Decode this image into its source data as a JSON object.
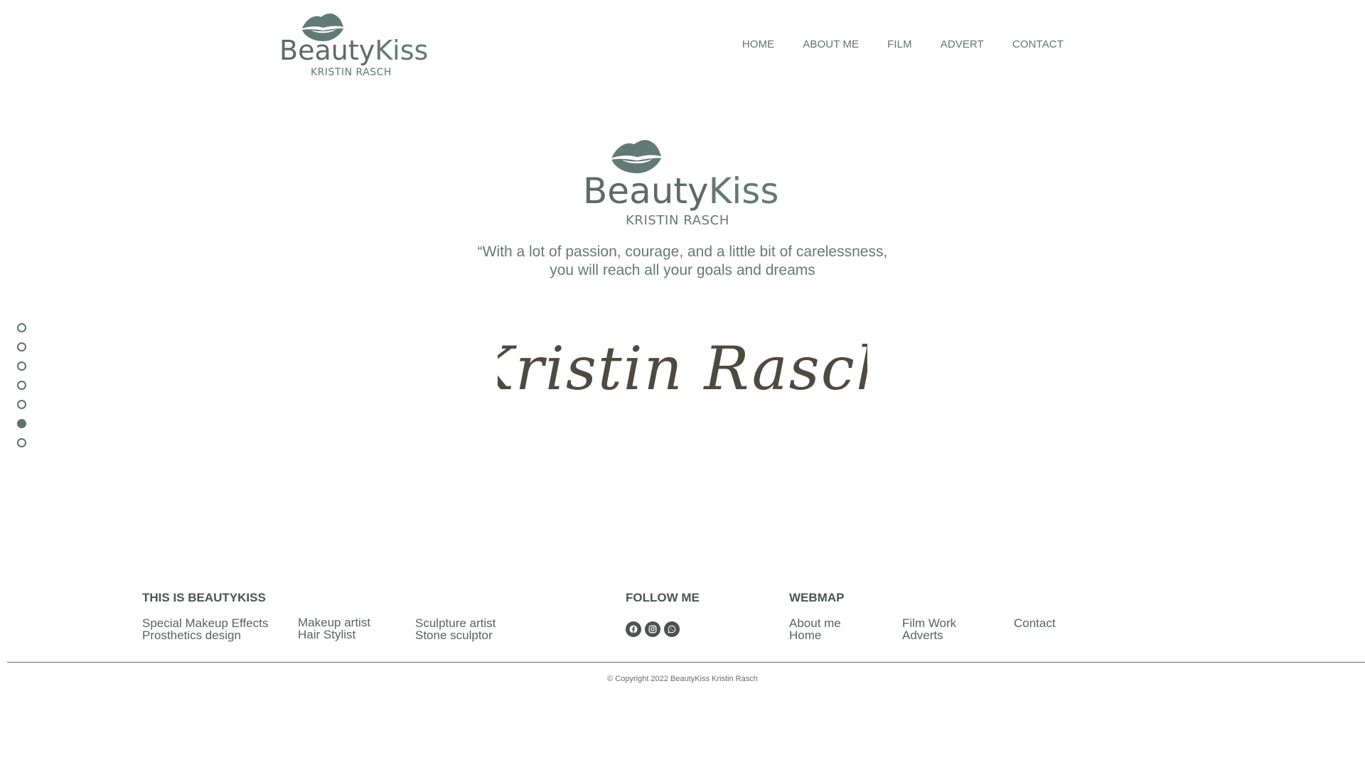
{
  "brand": {
    "logo_text_1": "Beauty",
    "logo_text_2": "Kiss",
    "logo_subtitle": "KRISTIN RASCH",
    "accent_color": "#637a74",
    "text_color": "#5f6b67"
  },
  "nav": {
    "items": [
      {
        "label": "HOME"
      },
      {
        "label": "ABOUT ME"
      },
      {
        "label": "FILM"
      },
      {
        "label": "ADVERT"
      },
      {
        "label": "CONTACT"
      }
    ]
  },
  "hero": {
    "quote_line1": "“With a lot of passion, courage, and a little bit of carelessness,",
    "quote_line2": "you will reach all your goals and dreams",
    "signature": "Kristin Rasch"
  },
  "side_nav": {
    "dots": 7,
    "active_index": 5
  },
  "footer": {
    "about": {
      "heading": "THIS IS BEAUTYKISS",
      "col1": [
        "Special Makeup Effects",
        "Prosthetics design"
      ],
      "col2": [
        "Makeup artist",
        "Hair Stylist"
      ],
      "col3": [
        "Sculpture artist",
        "Stone sculptor"
      ]
    },
    "follow": {
      "heading": "FOLLOW ME",
      "icons": [
        "facebook-icon",
        "instagram-icon",
        "whatsapp-icon"
      ]
    },
    "webmap": {
      "heading": "WEBMAP",
      "col1": [
        "About me",
        "Home"
      ],
      "col2": [
        "Film Work",
        "Adverts"
      ],
      "col3": [
        "Contact"
      ]
    },
    "copyright": "© Copyright 2022 BeautyKiss Kristin Rasch"
  }
}
